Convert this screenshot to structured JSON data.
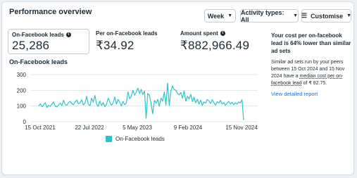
{
  "header": {
    "title": "Performance overview",
    "week_label": "Week",
    "activity_label": "Activity types: All",
    "customise_label": "Customise"
  },
  "metrics": [
    {
      "label": "On-Facebook leads",
      "value": "25,286",
      "info": true
    },
    {
      "label": "Per on-Facebook leads",
      "value": "₹34.92",
      "info": false
    },
    {
      "label": "Amount spent",
      "value": "₹882,966.49",
      "info": true
    }
  ],
  "chart_title": "On-Facebook leads",
  "legend_label": "On-Facebook leads",
  "side_panel": {
    "heading": "Your cost per on-facebook lead is 64% lower than similar ad sets",
    "body_prefix": "Similar ad sets run by your peers between 15 Oct 2024 and 15 Nov 2024 have a ",
    "body_link": "median cost per on-facebook lead",
    "body_suffix": " of ₹ 82.75.",
    "link": "View detailed report"
  },
  "chart_data": {
    "type": "line",
    "title": "On-Facebook leads",
    "x_tick_labels": [
      "15 Oct 2021",
      "22 Jul 2022",
      "5 May 2023",
      "9 Feb 2024",
      "15 Nov 2024"
    ],
    "ylim": [
      0,
      300
    ],
    "y_ticks": [
      0,
      100,
      200,
      300
    ],
    "grid": true,
    "legend": "bottom-center",
    "color": "#2ec4c9",
    "series": [
      {
        "name": "On-Facebook leads",
        "values": [
          100,
          115,
          95,
          108,
          120,
          90,
          104,
          98,
          112,
          126,
          100,
          94,
          108,
          118,
          102,
          136,
          110,
          104,
          122,
          130,
          116,
          108,
          126,
          138,
          114,
          120,
          140,
          106,
          118,
          162,
          110,
          102,
          150,
          124,
          168,
          112,
          98,
          132,
          104,
          122,
          96,
          110,
          150,
          126,
          104,
          118,
          158,
          112,
          142,
          124,
          100,
          130,
          108,
          118,
          190,
          146,
          160,
          200,
          168,
          188,
          214,
          180,
          206,
          172,
          196,
          22,
          180,
          168,
          114,
          50,
          136,
          118,
          142,
          98,
          150,
          130,
          190,
          106,
          246,
          102,
          198,
          226,
          204,
          200,
          180,
          170,
          186,
          150,
          196,
          132,
          162,
          144,
          174,
          128,
          156,
          120,
          142,
          112,
          138,
          104,
          126,
          118,
          142,
          132,
          116,
          140,
          122,
          106,
          128,
          118,
          136,
          112,
          122,
          104,
          118,
          130,
          112,
          124,
          108,
          120,
          112,
          126,
          120,
          140,
          10
        ]
      }
    ]
  }
}
